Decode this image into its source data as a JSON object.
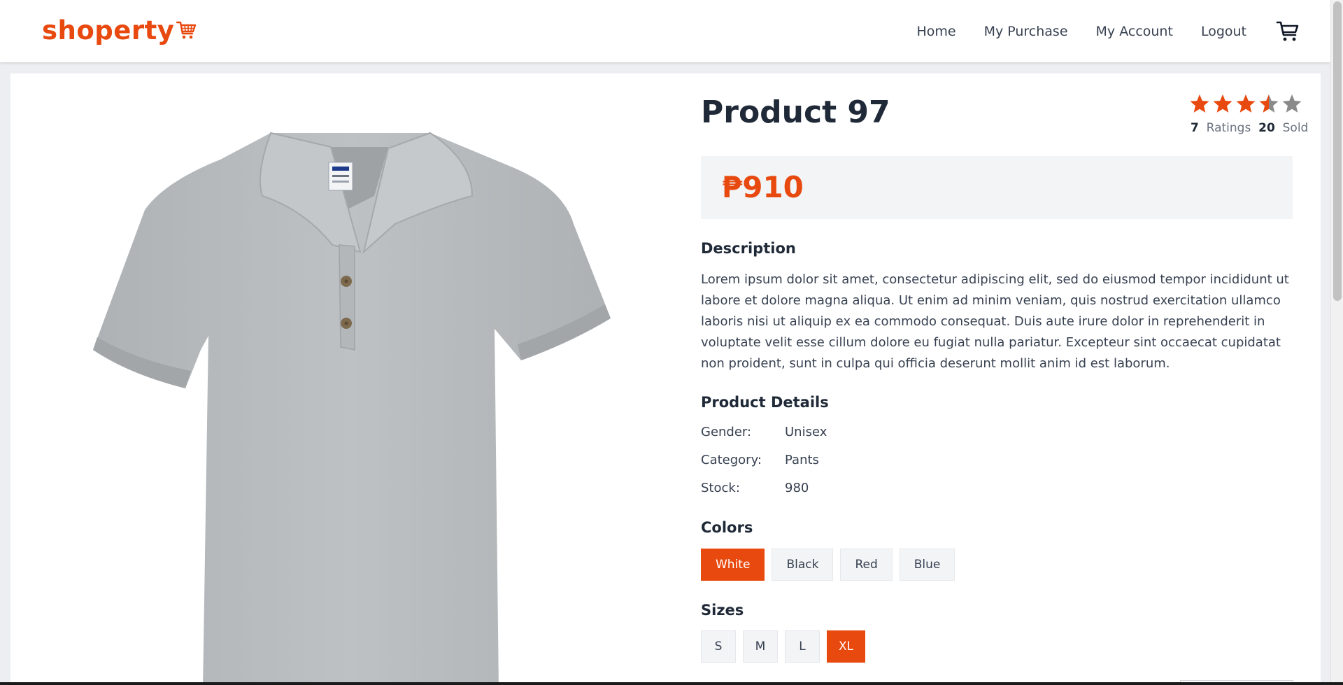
{
  "brand": {
    "name": "shoperty",
    "accent_color": "#e8490f"
  },
  "nav": {
    "links": [
      "Home",
      "My Purchase",
      "My Account",
      "Logout"
    ],
    "cart_icon": "cart-icon"
  },
  "product": {
    "title": "Product 97",
    "price": "₱910",
    "rating": {
      "value": 3.5,
      "max": 5,
      "count": "7",
      "count_label": "Ratings",
      "sold": "20",
      "sold_label": "Sold"
    },
    "description_heading": "Description",
    "description": "Lorem ipsum dolor sit amet, consectetur adipiscing elit, sed do eiusmod tempor incididunt ut labore et dolore magna aliqua. Ut enim ad minim veniam, quis nostrud exercitation ullamco laboris nisi ut aliquip ex ea commodo consequat. Duis aute irure dolor in reprehenderit in voluptate velit esse cillum dolore eu fugiat nulla pariatur. Excepteur sint occaecat cupidatat non proident, sunt in culpa qui officia deserunt mollit anim id est laborum.",
    "details_heading": "Product Details",
    "details": [
      {
        "label": "Gender:",
        "value": "Unisex"
      },
      {
        "label": "Category:",
        "value": "Pants"
      },
      {
        "label": "Stock:",
        "value": "980"
      }
    ],
    "colors_heading": "Colors",
    "colors": [
      {
        "label": "White",
        "selected": true
      },
      {
        "label": "Black",
        "selected": false
      },
      {
        "label": "Red",
        "selected": false
      },
      {
        "label": "Blue",
        "selected": false
      }
    ],
    "sizes_heading": "Sizes",
    "sizes": [
      {
        "label": "S",
        "selected": false
      },
      {
        "label": "M",
        "selected": false
      },
      {
        "label": "L",
        "selected": false
      },
      {
        "label": "XL",
        "selected": true
      }
    ],
    "image": {
      "icon": "polo-shirt-image",
      "shirt_color": "#b7bbbe"
    }
  }
}
